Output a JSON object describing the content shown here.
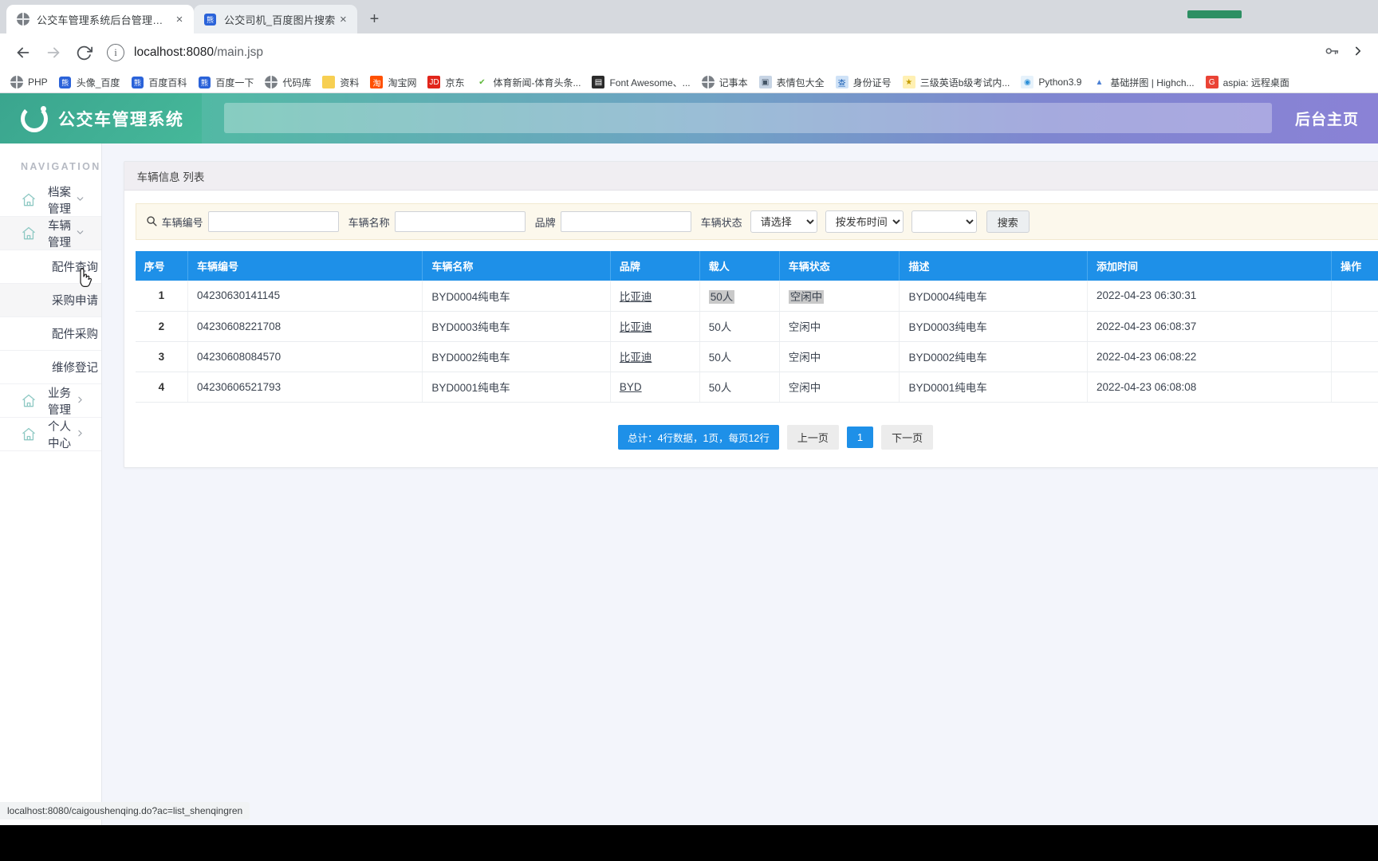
{
  "browser": {
    "tabs": [
      {
        "title": "公交车管理系统后台管理系统",
        "favicon": "globe-icon",
        "active": true,
        "close_label": "×"
      },
      {
        "title": "公交司机_百度图片搜索",
        "favicon": "baidu-paw-icon",
        "active": false,
        "close_label": "×"
      }
    ],
    "new_tab_label": "+",
    "nav": {
      "back_icon": "back-arrow-icon",
      "forward_icon": "forward-arrow-icon",
      "reload_icon": "reload-icon",
      "info_icon": "page-info-icon",
      "url_host": "localhost:8080",
      "url_path": "/main.jsp",
      "key_icon": "password-key-icon",
      "overflow_icon": "chevron-right-icon"
    },
    "bookmarks": [
      {
        "label": "PHP",
        "icon": "globe-icon"
      },
      {
        "label": "头像_百度",
        "icon": "baidu-paw-icon"
      },
      {
        "label": "百度百科",
        "icon": "baidu-paw-icon"
      },
      {
        "label": "百度一下",
        "icon": "baidu-paw-icon"
      },
      {
        "label": "代码库",
        "icon": "globe-icon"
      },
      {
        "label": "资料",
        "icon": "folder-icon"
      },
      {
        "label": "淘宝网",
        "icon": "taobao-icon"
      },
      {
        "label": "京东",
        "icon": "jd-icon"
      },
      {
        "label": "体育新闻-体育头条...",
        "icon": "check-icon"
      },
      {
        "label": "Font Awesome、...",
        "icon": "window-icon"
      },
      {
        "label": "记事本",
        "icon": "globe-icon"
      },
      {
        "label": "表情包大全",
        "icon": "image-icon"
      },
      {
        "label": "身份证号",
        "icon": "blue-doc-icon"
      },
      {
        "label": "三级英语b级考试内...",
        "icon": "yellow-doc-icon"
      },
      {
        "label": "Python3.9",
        "icon": "python-icon"
      },
      {
        "label": "基础拼图 | Highch...",
        "icon": "chart-icon"
      },
      {
        "label": "aspia: 远程桌面",
        "icon": "google-g-icon"
      }
    ],
    "status_text": "localhost:8080/caigoushenqing.do?ac=list_shenqingren"
  },
  "header": {
    "brand_title": "公交车管理系统",
    "brand_logo_icon": "spinner-ring-icon",
    "right_link": "后台主页",
    "search_placeholder": ""
  },
  "sidebar": {
    "caption": "NAVIGATION",
    "items": [
      {
        "label": "档案管理",
        "icon": "home-icon",
        "chevron": "chevron-down-icon",
        "type": "group",
        "highlight": false
      },
      {
        "label": "车辆管理",
        "icon": "home-icon",
        "chevron": "chevron-down-icon",
        "type": "group",
        "highlight": true
      },
      {
        "label": "配件查询",
        "type": "sub",
        "highlight": false
      },
      {
        "label": "采购申请",
        "type": "sub",
        "highlight": true
      },
      {
        "label": "配件采购",
        "type": "sub",
        "highlight": false
      },
      {
        "label": "维修登记",
        "type": "sub",
        "highlight": false
      },
      {
        "label": "业务管理",
        "icon": "home-icon",
        "chevron": "chevron-right-icon",
        "type": "group",
        "highlight": false
      },
      {
        "label": "个人中心",
        "icon": "home-icon",
        "chevron": "chevron-right-icon",
        "type": "group",
        "highlight": false
      }
    ]
  },
  "panel": {
    "title": "车辆信息 列表",
    "filters": {
      "search_icon": "search-icon",
      "field1_label": "车辆编号",
      "field1_value": "",
      "field2_label": "车辆名称",
      "field2_value": "",
      "field3_label": "品牌",
      "field3_value": "",
      "field4_label": "车辆状态",
      "select_status_value": "请选择",
      "select_sort_value": "按发布时间",
      "select_order_value": "",
      "search_button": "搜索"
    },
    "table": {
      "columns": [
        "序号",
        "车辆编号",
        "车辆名称",
        "品牌",
        "载人",
        "车辆状态",
        "描述",
        "添加时间",
        "操作"
      ],
      "rows": [
        {
          "序号": "1",
          "车辆编号": "04230630141145",
          "车辆名称": "BYD0004纯电车",
          "品牌": "比亚迪",
          "载人": "50人",
          "车辆状态": "空闲中",
          "描述": "BYD0004纯电车",
          "添加时间": "2022-04-23 06:30:31",
          "操作": "",
          "selected_cells": [
            "载人",
            "车辆状态"
          ]
        },
        {
          "序号": "2",
          "车辆编号": "04230608221708",
          "车辆名称": "BYD0003纯电车",
          "品牌": "比亚迪",
          "载人": "50人",
          "车辆状态": "空闲中",
          "描述": "BYD0003纯电车",
          "添加时间": "2022-04-23 06:08:37",
          "操作": "",
          "selected_cells": []
        },
        {
          "序号": "3",
          "车辆编号": "04230608084570",
          "车辆名称": "BYD0002纯电车",
          "品牌": "比亚迪",
          "载人": "50人",
          "车辆状态": "空闲中",
          "描述": "BYD0002纯电车",
          "添加时间": "2022-04-23 06:08:22",
          "操作": "",
          "selected_cells": []
        },
        {
          "序号": "4",
          "车辆编号": "04230606521793",
          "车辆名称": "BYD0001纯电车",
          "品牌": "BYD",
          "载人": "50人",
          "车辆状态": "空闲中",
          "描述": "BYD0001纯电车",
          "添加时间": "2022-04-23 06:08:08",
          "操作": "",
          "selected_cells": []
        }
      ]
    },
    "pagination": {
      "total_text": "总计：4行数据，1页，每页12行",
      "prev_label": "上一页",
      "current_page": "1",
      "next_label": "下一页"
    }
  },
  "colors": {
    "brand_green": "#43b095",
    "header_purple": "#8a82d6",
    "table_header_blue": "#1e90e8",
    "filter_bg": "#fcf8ec",
    "selection_gray": "#c9c9c9"
  }
}
